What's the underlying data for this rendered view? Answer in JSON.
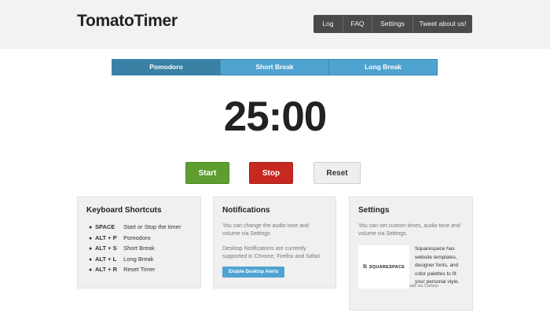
{
  "header": {
    "logo": "TomatoTimer",
    "nav": [
      "Log",
      "FAQ",
      "Settings",
      "Tweet about us!"
    ]
  },
  "tabs": [
    {
      "label": "Pomodoro",
      "active": true
    },
    {
      "label": "Short Break",
      "active": false
    },
    {
      "label": "Long Break",
      "active": false
    }
  ],
  "timer": {
    "display": "25:00"
  },
  "controls": {
    "start": "Start",
    "stop": "Stop",
    "reset": "Reset"
  },
  "shortcuts": {
    "title": "Keyboard Shortcuts",
    "items": [
      {
        "key": "SPACE",
        "action": "Start or Stop the timer"
      },
      {
        "key": "ALT + P",
        "action": "Pomodoro"
      },
      {
        "key": "ALT + S",
        "action": "Short Break"
      },
      {
        "key": "ALT + L",
        "action": "Long Break"
      },
      {
        "key": "ALT + R",
        "action": "Reset Timer"
      }
    ]
  },
  "notifications": {
    "title": "Notifications",
    "text1": "You can change the audio tone and volume via Settings",
    "text2": "Desktop Notifications are currently supported in Chrome, Firefox and Safari",
    "button": "Enable Desktop Alerts"
  },
  "settings": {
    "title": "Settings",
    "text": "You can set custom times, audio tone and volume via Settings.",
    "ad": {
      "logo_text": "SQUARESPACE",
      "copy": "Squarespace has website templates, designer fonts, and color palettes to fit your personal style.",
      "credit": "ads via Carbon"
    }
  },
  "colors": {
    "tab_active": "#3b80a5",
    "tab": "#4fa3d1",
    "start": "#5e9e31",
    "stop": "#c7281f",
    "nav_bg": "#4a4a4a"
  }
}
